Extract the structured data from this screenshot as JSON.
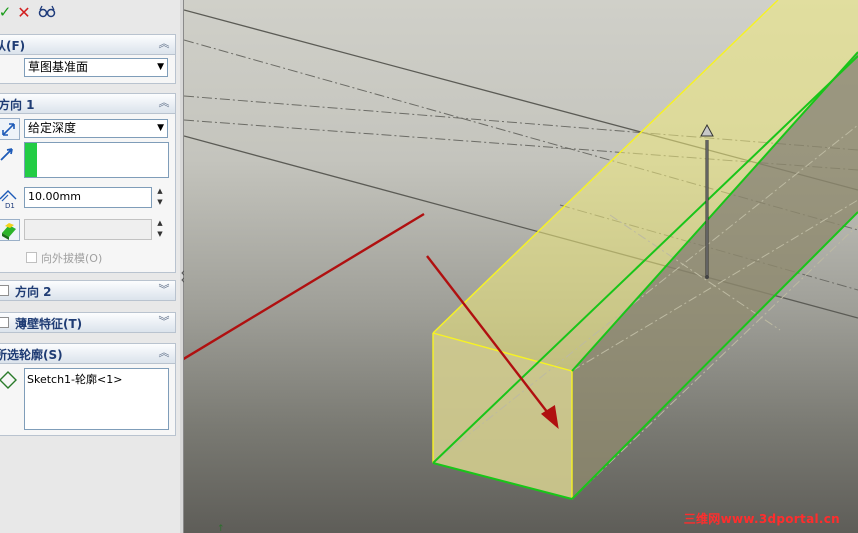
{
  "toolbar": {
    "ok_icon": "check-icon",
    "cancel_icon": "x-icon",
    "preview_icon": "glasses-icon"
  },
  "from_section": {
    "title": "从(F)",
    "start_condition": "草图基准面"
  },
  "direction1": {
    "title": "方向 1",
    "end_condition": "给定深度",
    "depth_value": "10.00mm",
    "draft_outward_label": "向外拔模(O)"
  },
  "direction2": {
    "title": "方向 2",
    "checked": false
  },
  "thin_feature": {
    "title": "薄壁特征(T)",
    "checked": false
  },
  "selected_contours": {
    "title": "所选轮廓(S)",
    "items": [
      "Sketch1-轮廓<1>"
    ]
  },
  "watermark": "三维网www.3dportal.cn",
  "colors": {
    "extrude_face": "#f0ec8c",
    "edge_green": "#19c519",
    "edge_yellow": "#f7f322",
    "arrow_red": "#b01010"
  }
}
